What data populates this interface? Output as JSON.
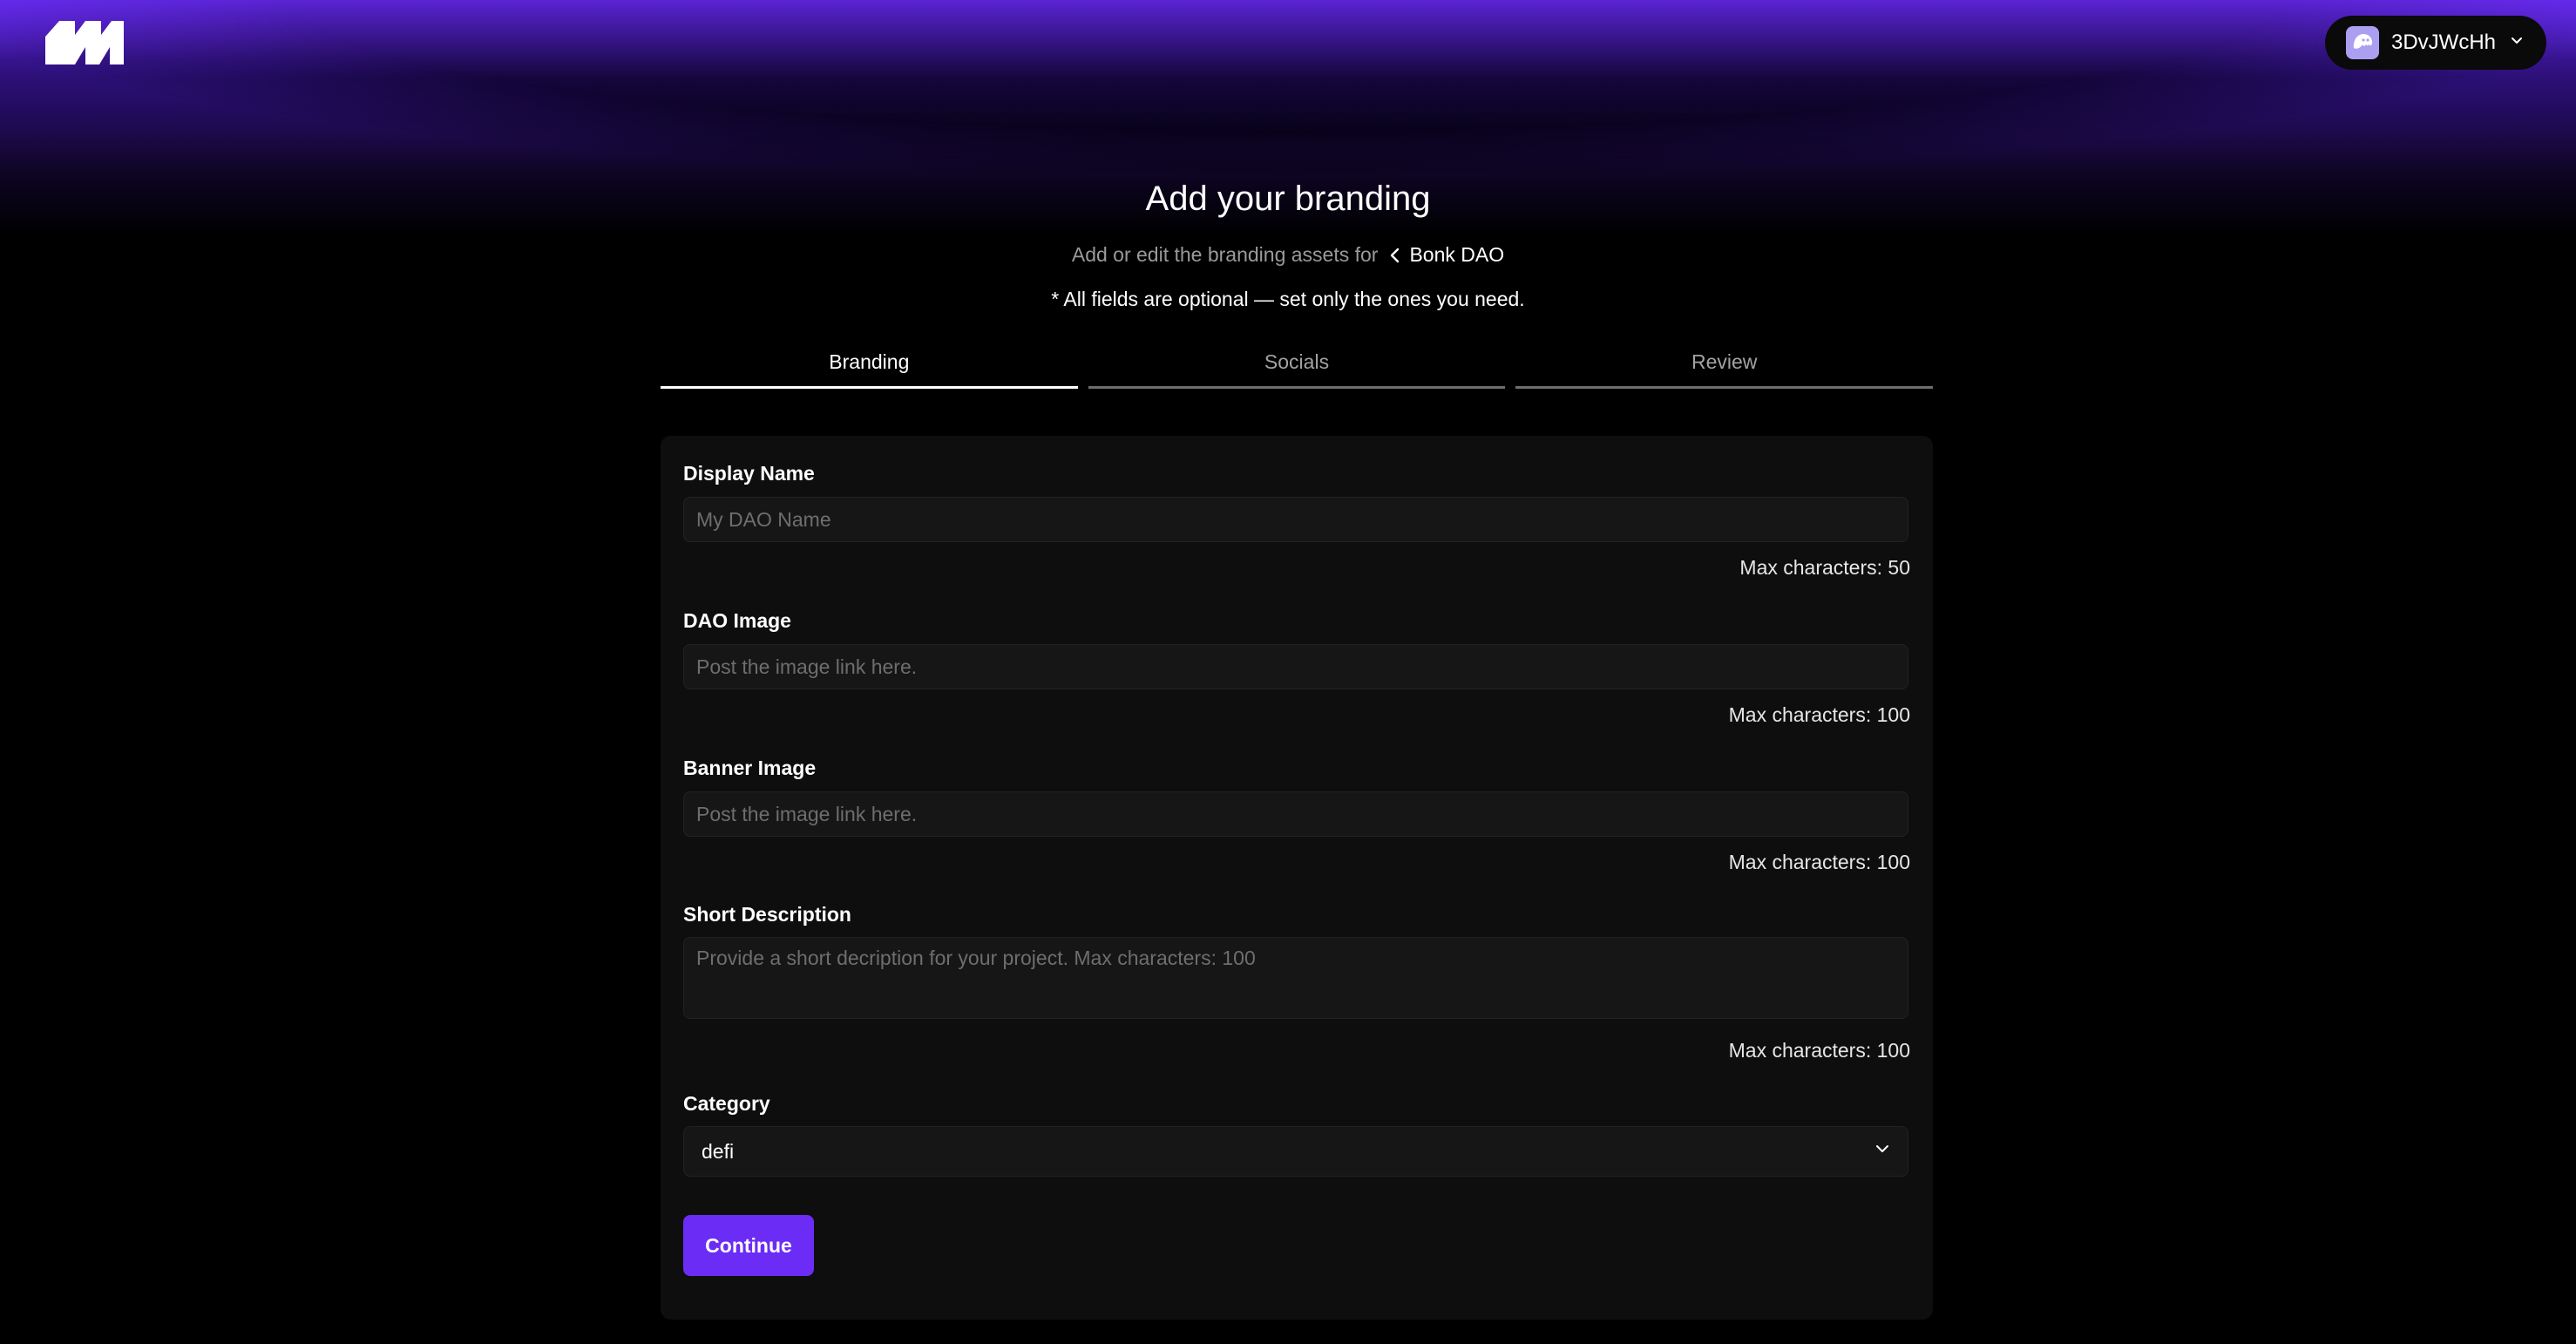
{
  "header": {
    "title": "Add your branding",
    "subtitle_prefix": "Add or edit the branding assets for",
    "dao_name": "Bonk DAO",
    "note": "* All fields are optional — set only the ones you need."
  },
  "wallet": {
    "address": "3DvJWcHh"
  },
  "tabs": [
    {
      "label": "Branding",
      "active": true
    },
    {
      "label": "Socials",
      "active": false
    },
    {
      "label": "Review",
      "active": false
    }
  ],
  "form": {
    "display_name": {
      "label": "Display Name",
      "placeholder": "My DAO Name",
      "value": "",
      "max": "Max characters: 50"
    },
    "dao_image": {
      "label": "DAO Image",
      "placeholder": "Post the image link here.",
      "value": "",
      "max": "Max characters: 100"
    },
    "banner_image": {
      "label": "Banner Image",
      "placeholder": "Post the image link here.",
      "value": "",
      "max": "Max characters: 100"
    },
    "short_description": {
      "label": "Short Description",
      "placeholder": "Provide a short decription for your project. Max characters: 100",
      "value": "",
      "max": "Max characters: 100"
    },
    "category": {
      "label": "Category",
      "selected": "defi"
    },
    "continue_label": "Continue"
  },
  "colors": {
    "accent": "#6b2cf5",
    "background": "#000000",
    "card": "#0e0e0e"
  },
  "icons": {
    "logo": "realms-logo-icon",
    "wallet": "phantom-ghost-icon",
    "dropdown": "chevron-down-icon",
    "back": "chevron-left-icon"
  }
}
